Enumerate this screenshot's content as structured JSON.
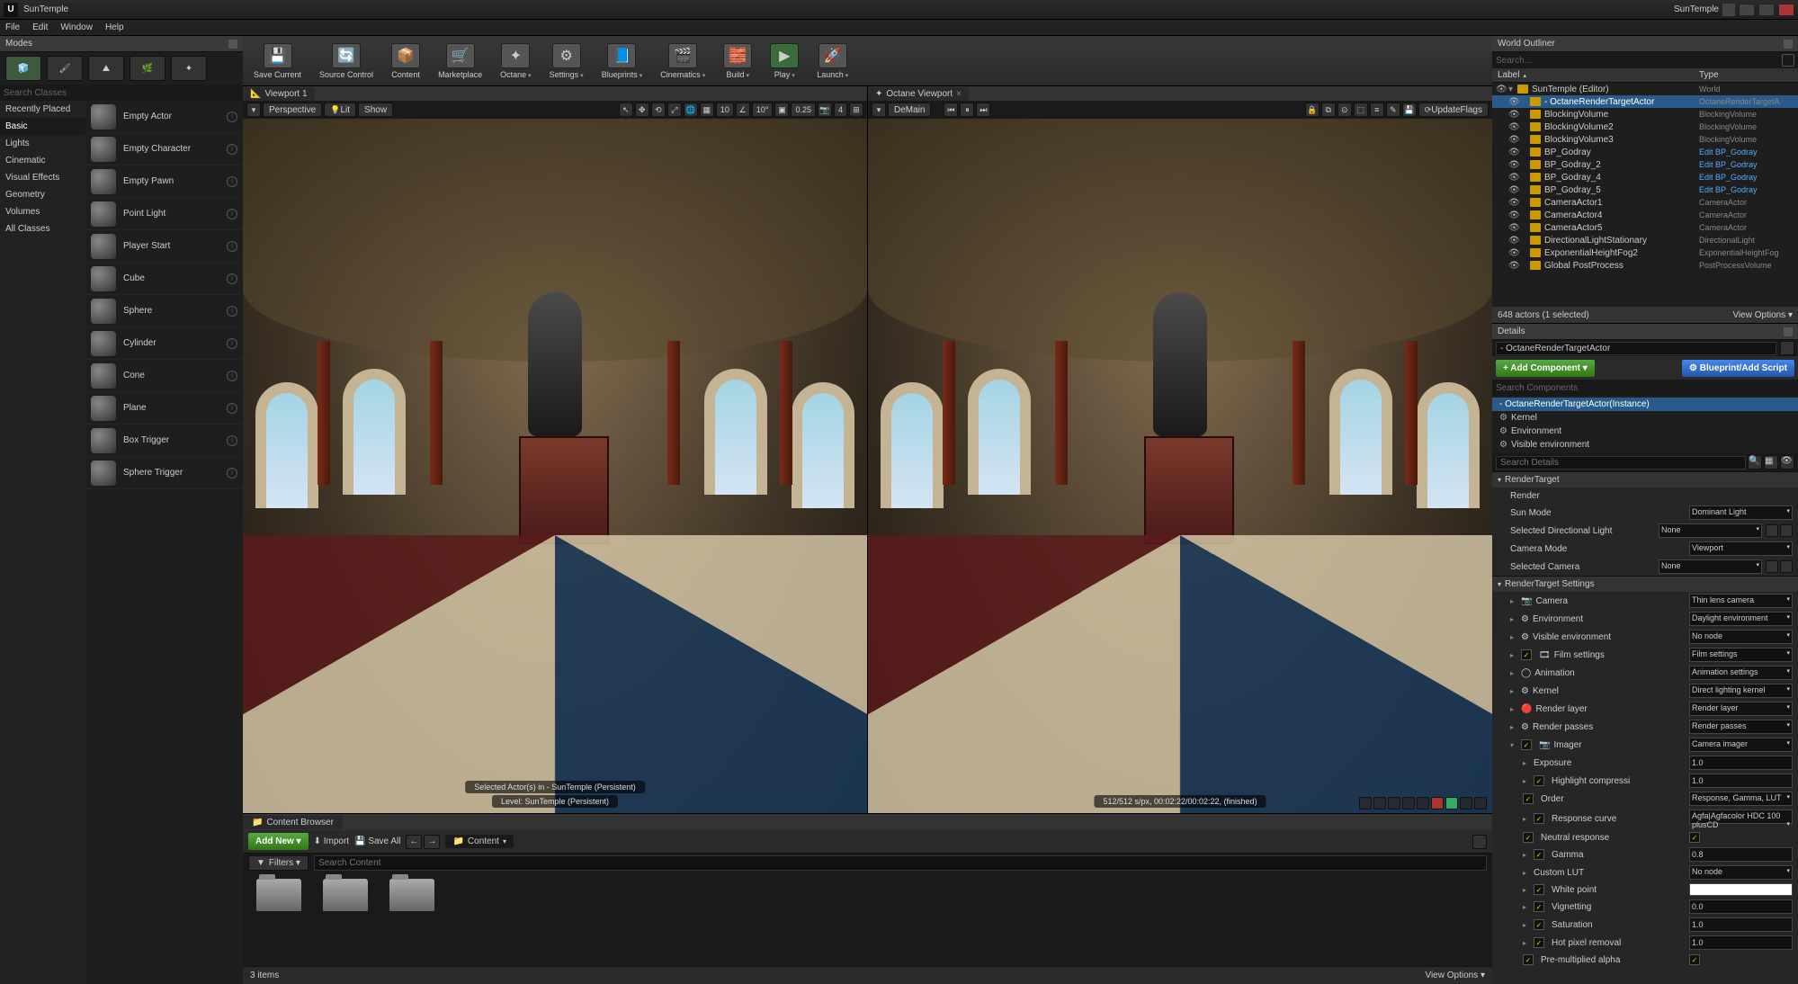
{
  "title": "SunTemple",
  "projectName": "SunTemple",
  "menu": [
    "File",
    "Edit",
    "Window",
    "Help"
  ],
  "modes": {
    "title": "Modes",
    "searchPlaceholder": "Search Classes",
    "categories": [
      "Recently Placed",
      "Basic",
      "Lights",
      "Cinematic",
      "Visual Effects",
      "Geometry",
      "Volumes",
      "All Classes"
    ],
    "activeCategory": "Basic",
    "actors": [
      "Empty Actor",
      "Empty Character",
      "Empty Pawn",
      "Point Light",
      "Player Start",
      "Cube",
      "Sphere",
      "Cylinder",
      "Cone",
      "Plane",
      "Box Trigger",
      "Sphere Trigger"
    ]
  },
  "toolbar": [
    {
      "label": "Save Current",
      "icon": "💾"
    },
    {
      "label": "Source Control",
      "icon": "🔄"
    },
    {
      "label": "Content",
      "icon": "📦"
    },
    {
      "label": "Marketplace",
      "icon": "🛒"
    },
    {
      "label": "Octane",
      "icon": "✦",
      "drop": true
    },
    {
      "label": "Settings",
      "icon": "⚙",
      "drop": true
    },
    {
      "label": "Blueprints",
      "icon": "📘",
      "drop": true
    },
    {
      "label": "Cinematics",
      "icon": "🎬",
      "drop": true
    },
    {
      "label": "Build",
      "icon": "🧱",
      "drop": true
    },
    {
      "label": "Play",
      "icon": "▶",
      "drop": true,
      "play": true
    },
    {
      "label": "Launch",
      "icon": "🚀",
      "drop": true
    }
  ],
  "viewport1": {
    "tab": "Viewport 1",
    "perspective": "Perspective",
    "lit": "Lit",
    "show": "Show",
    "snap": "10",
    "angle": "10°",
    "scale": "0.25",
    "cam": "4",
    "overlayTop": "Selected Actor(s) in - SunTemple (Persistent)",
    "overlay": "Level: SunTemple (Persistent)"
  },
  "viewport2": {
    "tab": "Octane Viewport",
    "demain": "DeMain",
    "updateFlags": "UpdateFlags",
    "status": "512/512 s/px, 00:02:22/00:02:22, (finished)"
  },
  "outliner": {
    "title": "World Outliner",
    "search": "Search...",
    "colLabel": "Label",
    "colType": "Type",
    "rows": [
      {
        "label": "SunTemple (Editor)",
        "type": "World",
        "indent": 0,
        "arrow": "▾"
      },
      {
        "label": "- OctaneRenderTargetActor",
        "type": "OctaneRenderTargetA",
        "indent": 1,
        "sel": true
      },
      {
        "label": "BlockingVolume",
        "type": "BlockingVolume",
        "indent": 1
      },
      {
        "label": "BlockingVolume2",
        "type": "BlockingVolume",
        "indent": 1
      },
      {
        "label": "BlockingVolume3",
        "type": "BlockingVolume",
        "indent": 1
      },
      {
        "label": "BP_Godray",
        "type": "Edit BP_Godray",
        "indent": 1,
        "link": true
      },
      {
        "label": "BP_Godray_2",
        "type": "Edit BP_Godray",
        "indent": 1,
        "link": true
      },
      {
        "label": "BP_Godray_4",
        "type": "Edit BP_Godray",
        "indent": 1,
        "link": true
      },
      {
        "label": "BP_Godray_5",
        "type": "Edit BP_Godray",
        "indent": 1,
        "link": true
      },
      {
        "label": "CameraActor1",
        "type": "CameraActor",
        "indent": 1
      },
      {
        "label": "CameraActor4",
        "type": "CameraActor",
        "indent": 1
      },
      {
        "label": "CameraActor5",
        "type": "CameraActor",
        "indent": 1
      },
      {
        "label": "DirectionalLightStationary",
        "type": "DirectionalLight",
        "indent": 1
      },
      {
        "label": "ExponentialHeightFog2",
        "type": "ExponentialHeightFog",
        "indent": 1
      },
      {
        "label": "Global PostProcess",
        "type": "PostProcessVolume",
        "indent": 1
      }
    ],
    "footer": "648 actors (1 selected)",
    "viewOptions": "View Options ▾"
  },
  "details": {
    "title": "Details",
    "actorName": "- OctaneRenderTargetActor",
    "addComponent": "+ Add Component ▾",
    "blueprintBtn": "⚙ Blueprint/Add Script",
    "searchComponents": "Search Components",
    "components": [
      {
        "label": "- OctaneRenderTargetActor(Instance)",
        "sel": true
      },
      {
        "label": "Kernel",
        "gear": true
      },
      {
        "label": "Environment",
        "gear": true
      },
      {
        "label": "Visible environment",
        "gear": true
      }
    ],
    "searchDetails": "Search Details",
    "sections": [
      {
        "head": "RenderTarget",
        "rows": [
          {
            "label": "Render",
            "type": "label"
          },
          {
            "label": "Sun Mode",
            "type": "combo",
            "val": "Dominant Light"
          },
          {
            "label": "Selected Directional Light",
            "type": "combo",
            "val": "None",
            "extra": true
          },
          {
            "label": "Camera Mode",
            "type": "combo",
            "val": "Viewport"
          },
          {
            "label": "Selected Camera",
            "type": "combo",
            "val": "None",
            "extra": true
          }
        ]
      },
      {
        "head": "RenderTarget Settings",
        "rows": [
          {
            "label": "Camera",
            "type": "combo",
            "val": "Thin lens camera",
            "tri": true,
            "icn": "📷"
          },
          {
            "label": "Environment",
            "type": "combo",
            "val": "Daylight environment",
            "tri": true,
            "icn": "⚙"
          },
          {
            "label": "Visible environment",
            "type": "combo",
            "val": "No node",
            "tri": true,
            "icn": "⚙"
          },
          {
            "label": "Film settings",
            "type": "combo",
            "val": "Film settings",
            "tri": true,
            "chk": true,
            "icn": "🎞"
          },
          {
            "label": "Animation",
            "type": "combo",
            "val": "Animation settings",
            "tri": true,
            "icn": "◯"
          },
          {
            "label": "Kernel",
            "type": "combo",
            "val": "Direct lighting kernel",
            "tri": true,
            "icn": "⚙"
          },
          {
            "label": "Render layer",
            "type": "combo",
            "val": "Render layer",
            "tri": true,
            "icn": "🔴"
          },
          {
            "label": "Render passes",
            "type": "combo",
            "val": "Render passes",
            "tri": true,
            "icn": "⚙"
          },
          {
            "label": "Imager",
            "type": "combo",
            "val": "Camera imager",
            "tri": "▾",
            "chk": true,
            "icn": "📷"
          },
          {
            "label": "Exposure",
            "type": "text",
            "val": "1.0",
            "tri": true,
            "indent": true
          },
          {
            "label": "Highlight compressi",
            "type": "text",
            "val": "1.0",
            "tri": true,
            "chk": true,
            "indent": true
          },
          {
            "label": "Order",
            "type": "combo",
            "val": "Response, Gamma, LUT",
            "chk": true,
            "indent": true
          },
          {
            "label": "Response curve",
            "type": "combo",
            "val": "Agfa|Agfacolor HDC 100 plusCD",
            "tri": true,
            "chk": true,
            "indent": true
          },
          {
            "label": "Neutral response",
            "type": "check",
            "val": "1",
            "chk": true,
            "indent": true
          },
          {
            "label": "Gamma",
            "type": "text",
            "val": "0.8",
            "tri": true,
            "chk": true,
            "indent": true
          },
          {
            "label": "Custom LUT",
            "type": "combo",
            "val": "No node",
            "tri": true,
            "indent": true
          },
          {
            "label": "White point",
            "type": "color",
            "tri": true,
            "chk": true,
            "indent": true
          },
          {
            "label": "Vignetting",
            "type": "text",
            "val": "0.0",
            "tri": true,
            "chk": true,
            "indent": true
          },
          {
            "label": "Saturation",
            "type": "text",
            "val": "1.0",
            "tri": true,
            "chk": true,
            "indent": true
          },
          {
            "label": "Hot pixel removal",
            "type": "text",
            "val": "1.0",
            "tri": true,
            "chk": true,
            "indent": true
          },
          {
            "label": "Pre-multiplied alpha",
            "type": "check",
            "val": "1",
            "chk": true,
            "indent": true
          }
        ]
      }
    ]
  },
  "contentBrowser": {
    "title": "Content Browser",
    "addNew": "Add New ▾",
    "import": "Import",
    "saveAll": "Save All",
    "path": "Content",
    "filters": "Filters ▾",
    "searchPlaceholder": "Search Content",
    "items": "3 items",
    "viewOptions": "View Options ▾"
  }
}
